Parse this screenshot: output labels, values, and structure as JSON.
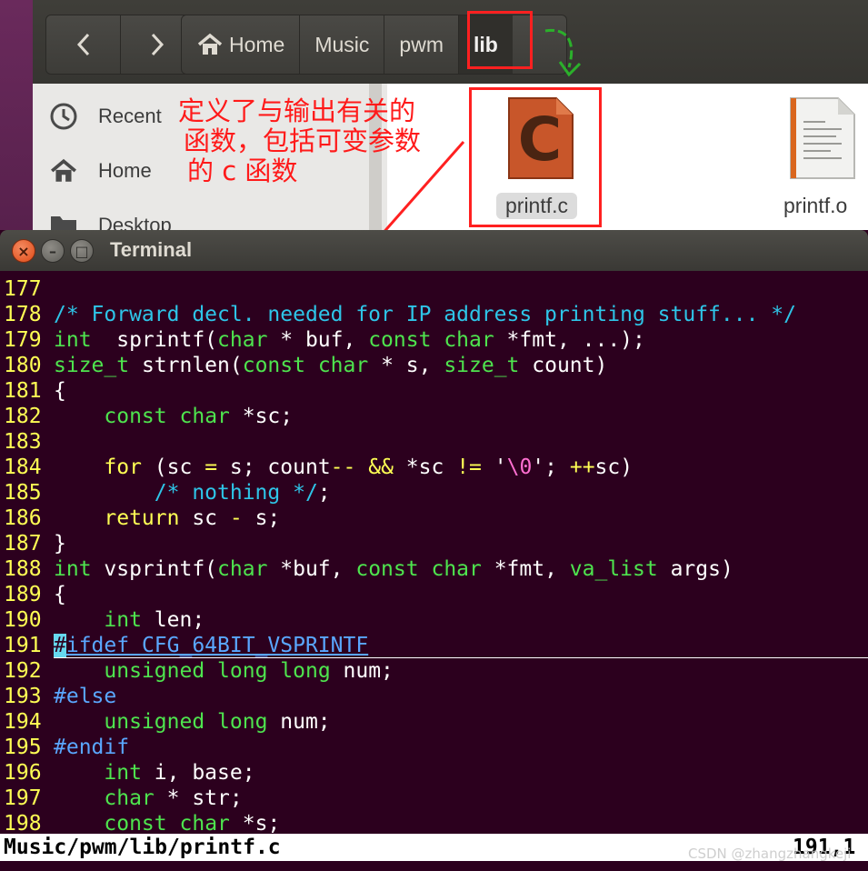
{
  "file_manager": {
    "nav": {
      "back": "‹",
      "forward": "›"
    },
    "breadcrumb": [
      "Home",
      "Music",
      "pwm",
      "lib"
    ],
    "sidebar": [
      {
        "label": "Recent",
        "icon": "clock-icon"
      },
      {
        "label": "Home",
        "icon": "home-icon"
      },
      {
        "label": "Desktop",
        "icon": "folder-icon"
      }
    ],
    "files": [
      {
        "name": "printf.c",
        "icon": "c-source-file-icon"
      },
      {
        "name": "printf.o",
        "icon": "object-file-icon"
      }
    ]
  },
  "annotation": {
    "lines": [
      "定义了与输出有关的",
      "函数，包括可变参数",
      "的 c 函数"
    ],
    "color": "#ff1a1a"
  },
  "terminal": {
    "title": "Terminal",
    "lines": [
      {
        "n": "177",
        "t": []
      },
      {
        "n": "178",
        "t": [
          [
            "cm",
            "/* Forward decl. needed for IP address printing stuff... */"
          ]
        ]
      },
      {
        "n": "179",
        "t": [
          [
            "ty",
            "int"
          ],
          [
            "",
            "  sprintf("
          ],
          [
            "ty",
            "char"
          ],
          [
            "",
            " * buf, "
          ],
          [
            "ty",
            "const"
          ],
          [
            "",
            " "
          ],
          [
            "ty",
            "char"
          ],
          [
            "",
            " *fmt, ...);"
          ]
        ]
      },
      {
        "n": "180",
        "t": [
          [
            "ty",
            "size_t"
          ],
          [
            "",
            " strnlen("
          ],
          [
            "ty",
            "const"
          ],
          [
            "",
            " "
          ],
          [
            "ty",
            "char"
          ],
          [
            "",
            " * s, "
          ],
          [
            "ty",
            "size_t"
          ],
          [
            "",
            " count)"
          ]
        ]
      },
      {
        "n": "181",
        "t": [
          [
            "",
            "{"
          ]
        ]
      },
      {
        "n": "182",
        "t": [
          [
            "",
            "    "
          ],
          [
            "ty",
            "const"
          ],
          [
            "",
            " "
          ],
          [
            "ty",
            "char"
          ],
          [
            "",
            " *sc;"
          ]
        ]
      },
      {
        "n": "183",
        "t": []
      },
      {
        "n": "184",
        "t": [
          [
            "",
            "    "
          ],
          [
            "kw",
            "for"
          ],
          [
            "",
            " (sc "
          ],
          [
            "kw",
            "="
          ],
          [
            "",
            " s; count"
          ],
          [
            "kw",
            "--"
          ],
          [
            "",
            " "
          ],
          [
            "kw",
            "&&"
          ],
          [
            "",
            " *sc "
          ],
          [
            "kw",
            "!="
          ],
          [
            "",
            " '"
          ],
          [
            "str",
            "\\0"
          ],
          [
            "",
            "'; "
          ],
          [
            "kw",
            "++"
          ],
          [
            "",
            "sc)"
          ]
        ]
      },
      {
        "n": "185",
        "t": [
          [
            "",
            "        "
          ],
          [
            "cm",
            "/* nothing */"
          ],
          [
            "",
            ";"
          ]
        ]
      },
      {
        "n": "186",
        "t": [
          [
            "",
            "    "
          ],
          [
            "kw",
            "return"
          ],
          [
            "",
            " sc "
          ],
          [
            "kw",
            "-"
          ],
          [
            "",
            " s;"
          ]
        ]
      },
      {
        "n": "187",
        "t": [
          [
            "",
            "}"
          ]
        ]
      },
      {
        "n": "188",
        "t": [
          [
            "ty",
            "int"
          ],
          [
            "",
            " vsprintf("
          ],
          [
            "ty",
            "char"
          ],
          [
            "",
            " *buf, "
          ],
          [
            "ty",
            "const"
          ],
          [
            "",
            " "
          ],
          [
            "ty",
            "char"
          ],
          [
            "",
            " *fmt, "
          ],
          [
            "ty",
            "va_list"
          ],
          [
            "",
            " args)"
          ]
        ]
      },
      {
        "n": "189",
        "t": [
          [
            "",
            "{"
          ]
        ]
      },
      {
        "n": "190",
        "t": [
          [
            "",
            "    "
          ],
          [
            "ty",
            "int"
          ],
          [
            "",
            " len;"
          ]
        ]
      },
      {
        "n": "191",
        "t": [
          [
            "cur",
            "#"
          ],
          [
            "pp ul",
            "ifdef CFG_64BIT_VSPRINTF"
          ]
        ],
        "cursorline": true
      },
      {
        "n": "192",
        "t": [
          [
            "",
            "    "
          ],
          [
            "ty",
            "unsigned"
          ],
          [
            "",
            " "
          ],
          [
            "ty",
            "long"
          ],
          [
            "",
            " "
          ],
          [
            "ty",
            "long"
          ],
          [
            "",
            " num;"
          ]
        ]
      },
      {
        "n": "193",
        "t": [
          [
            "pp",
            "#else"
          ]
        ]
      },
      {
        "n": "194",
        "t": [
          [
            "",
            "    "
          ],
          [
            "ty",
            "unsigned"
          ],
          [
            "",
            " "
          ],
          [
            "ty",
            "long"
          ],
          [
            "",
            " num;"
          ]
        ]
      },
      {
        "n": "195",
        "t": [
          [
            "pp",
            "#endif"
          ]
        ]
      },
      {
        "n": "196",
        "t": [
          [
            "",
            "    "
          ],
          [
            "ty",
            "int"
          ],
          [
            "",
            " i, base;"
          ]
        ]
      },
      {
        "n": "197",
        "t": [
          [
            "",
            "    "
          ],
          [
            "ty",
            "char"
          ],
          [
            "",
            " * str;"
          ]
        ]
      },
      {
        "n": "198",
        "t": [
          [
            "",
            "    "
          ],
          [
            "ty",
            "const"
          ],
          [
            "",
            " "
          ],
          [
            "ty",
            "char"
          ],
          [
            "",
            " *s;"
          ]
        ]
      }
    ],
    "status": {
      "file": "Music/pwm/lib/printf.c",
      "position": "191,1"
    }
  },
  "watermark": "CSDN @zhangzhangkeji"
}
